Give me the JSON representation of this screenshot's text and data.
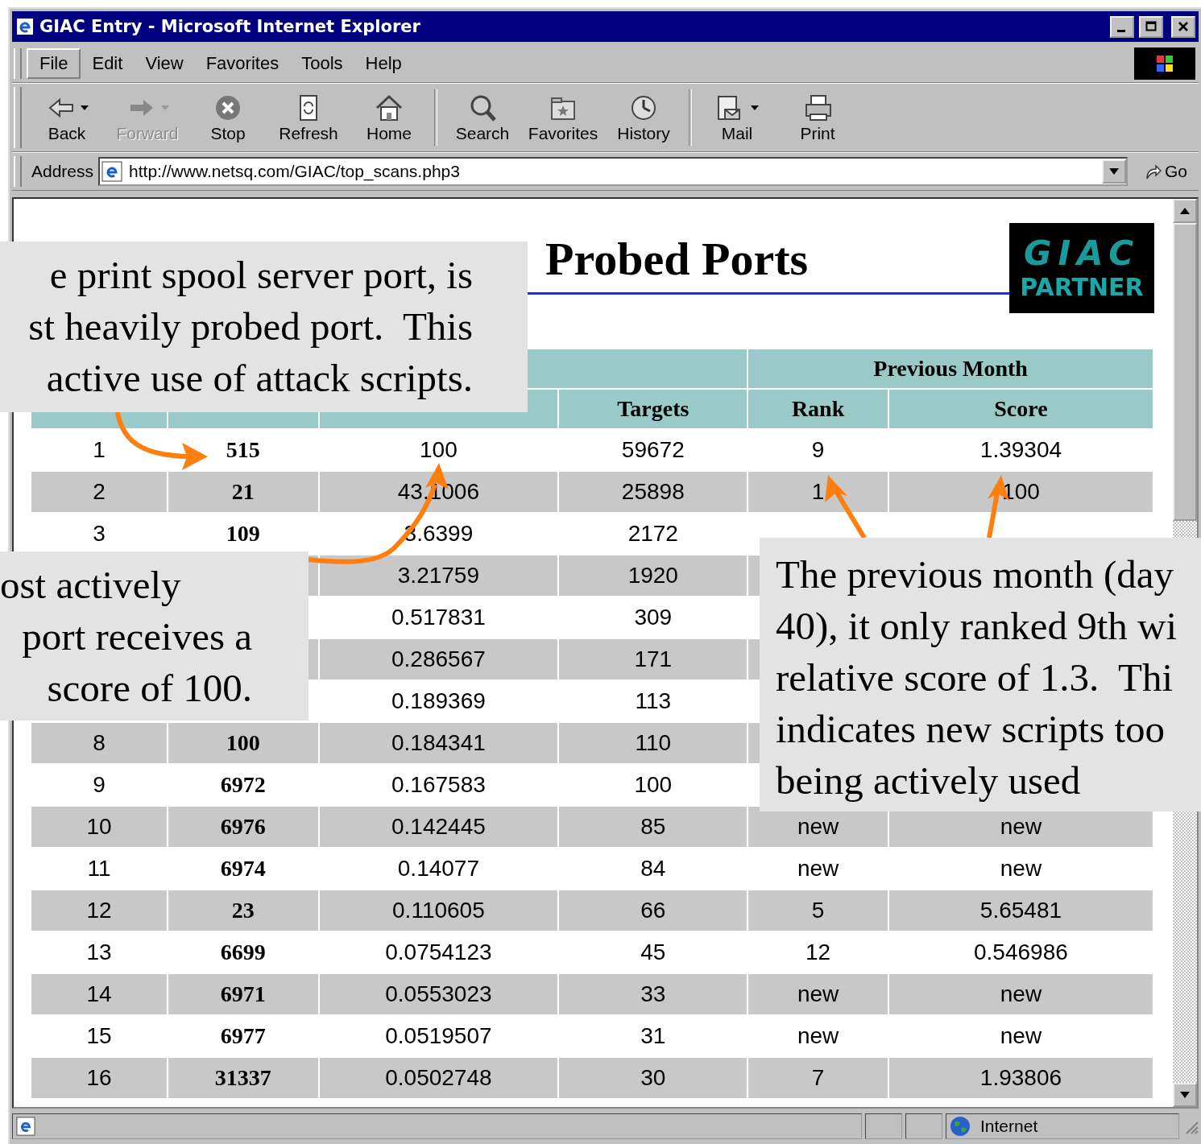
{
  "window": {
    "title": "GIAC Entry - Microsoft Internet Explorer"
  },
  "menu": [
    {
      "label": "File",
      "selected": true
    },
    {
      "label": "Edit",
      "selected": false
    },
    {
      "label": "View",
      "selected": false
    },
    {
      "label": "Favorites",
      "selected": false
    },
    {
      "label": "Tools",
      "selected": false
    },
    {
      "label": "Help",
      "selected": false
    }
  ],
  "toolbar": [
    {
      "label": "Back",
      "kind": "back",
      "disabled": false,
      "dropdown": true
    },
    {
      "label": "Forward",
      "kind": "forward",
      "disabled": true,
      "dropdown": true
    },
    {
      "label": "Stop",
      "kind": "stop",
      "disabled": false,
      "dropdown": false
    },
    {
      "label": "Refresh",
      "kind": "refresh",
      "disabled": false,
      "dropdown": false
    },
    {
      "label": "Home",
      "kind": "home",
      "disabled": false,
      "dropdown": false
    },
    {
      "kind": "separator"
    },
    {
      "label": "Search",
      "kind": "search",
      "disabled": false,
      "dropdown": false
    },
    {
      "label": "Favorites",
      "kind": "favorites",
      "disabled": false,
      "dropdown": false
    },
    {
      "label": "History",
      "kind": "history",
      "disabled": false,
      "dropdown": false
    },
    {
      "kind": "separator"
    },
    {
      "label": "Mail",
      "kind": "mail",
      "disabled": false,
      "dropdown": true
    },
    {
      "label": "Print",
      "kind": "print",
      "disabled": false,
      "dropdown": false
    }
  ],
  "address": {
    "label": "Address",
    "value": "http://www.netsq.com/GIAC/top_scans.php3",
    "go": "Go"
  },
  "page": {
    "title": "Probed Ports",
    "logo": {
      "top": "GIAC",
      "bottom": "PARTNER"
    },
    "table": {
      "group_header": "Previous Month",
      "columns": [
        null,
        null,
        null,
        "Targets",
        "Rank",
        "Score"
      ],
      "rows": [
        {
          "rank": "1",
          "port": "515",
          "score": "100",
          "targets": "59672",
          "prev_rank": "9",
          "prev_score": "1.39304"
        },
        {
          "rank": "2",
          "port": "21",
          "score": "43.1006",
          "targets": "25898",
          "prev_rank": "1",
          "prev_score": "100"
        },
        {
          "rank": "3",
          "port": "109",
          "score": "3.6399",
          "targets": "2172"
        },
        {
          "score": "3.21759",
          "targets": "1920"
        },
        {
          "score": "0.517831",
          "targets": "309"
        },
        {
          "score": "0.286567",
          "targets": "171"
        },
        {
          "score": "0.189369",
          "targets": "113"
        },
        {
          "rank": "8",
          "port": "100",
          "score": "0.184341",
          "targets": "110"
        },
        {
          "rank": "9",
          "port": "6972",
          "score": "0.167583",
          "targets": "100"
        },
        {
          "rank": "10",
          "port": "6976",
          "score": "0.142445",
          "targets": "85",
          "prev_rank": "new",
          "prev_score": "new"
        },
        {
          "rank": "11",
          "port": "6974",
          "score": "0.14077",
          "targets": "84",
          "prev_rank": "new",
          "prev_score": "new"
        },
        {
          "rank": "12",
          "port": "23",
          "score": "0.110605",
          "targets": "66",
          "prev_rank": "5",
          "prev_score": "5.65481"
        },
        {
          "rank": "13",
          "port": "6699",
          "score": "0.0754123",
          "targets": "45",
          "prev_rank": "12",
          "prev_score": "0.546986"
        },
        {
          "rank": "14",
          "port": "6971",
          "score": "0.0553023",
          "targets": "33",
          "prev_rank": "new",
          "prev_score": "new"
        },
        {
          "rank": "15",
          "port": "6977",
          "score": "0.0519507",
          "targets": "31",
          "prev_rank": "new",
          "prev_score": "new"
        },
        {
          "rank": "16",
          "port": "31337",
          "score": "0.0502748",
          "targets": "30",
          "prev_rank": "7",
          "prev_score": "1.93806"
        }
      ]
    }
  },
  "status_bar": {
    "zone": "Internet"
  },
  "callouts": [
    {
      "lines": [
        "e print spool server port, is",
        "st heavily probed port.  This",
        " active use of attack scripts."
      ]
    },
    {
      "lines": [
        "ost actively",
        "port receives a",
        "score of 100."
      ]
    },
    {
      "lines": [
        "The previous month (day",
        "40), it only ranked 9th wi",
        "relative score of 1.3.  Thi",
        "indicates new scripts too",
        "being actively used"
      ]
    }
  ]
}
